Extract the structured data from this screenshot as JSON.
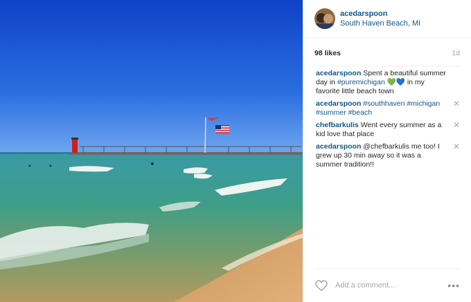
{
  "post": {
    "username": "acedarspoon",
    "location": "South Haven Beach, MI",
    "likes": "98 likes",
    "age": "1d"
  },
  "caption": {
    "user": "acedarspoon",
    "text_a": "Spent a beautiful summer day in ",
    "hashtag": "#puremichigan",
    "emoji": "💚💙",
    "text_b": " in my favorite little beach town"
  },
  "comments": [
    {
      "user": "acedarspoon",
      "text": "#southhaven #michigan #summer #beach",
      "is_tags": true
    },
    {
      "user": "chefbarkulis",
      "text": "Went every summer as a kid love that place",
      "is_tags": false
    },
    {
      "user": "acedarspoon",
      "text": "@chefbarkulis me too! I grew up 30 min away so it was a summer tradition!!",
      "is_tags": false
    }
  ],
  "footer": {
    "comment_placeholder": "Add a comment...",
    "more_label": "•••",
    "close_label": "✕"
  },
  "icons": {
    "heart": "heart-icon",
    "close": "close-icon",
    "more": "more-icon"
  },
  "colors": {
    "link": "#125688",
    "muted": "#a5a7aa",
    "sky": "#1a55d6",
    "water": "#2f8fa0",
    "sand": "#d6a46a"
  }
}
